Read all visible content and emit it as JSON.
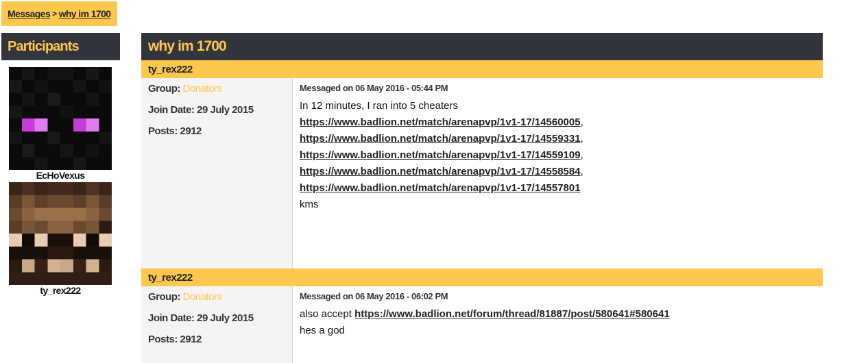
{
  "breadcrumb": {
    "root": "Messages",
    "sep": ">",
    "current": "why im 1700"
  },
  "participants": {
    "heading": "Participants",
    "list": [
      {
        "name": "EcHoVexus",
        "avatar": "enderman-skin-avatar"
      },
      {
        "name": "ty_rex222",
        "avatar": "brown-skin-avatar"
      }
    ]
  },
  "thread": {
    "title": "why im 1700",
    "messages": [
      {
        "author": "ty_rex222",
        "group_label": "Group:",
        "group": "Donators",
        "join": "Join Date: 29 July 2015",
        "posts": "Posts: 2912",
        "meta": "Messaged on 06 May 2016 - 05:44 PM",
        "intro": "In 12 minutes, I ran into 5 cheaters",
        "links": [
          "https://www.badlion.net/match/arenapvp/1v1-17/14560005",
          "https://www.badlion.net/match/arenapvp/1v1-17/14559331",
          "https://www.badlion.net/match/arenapvp/1v1-17/14559109",
          "https://www.badlion.net/match/arenapvp/1v1-17/14558584",
          "https://www.badlion.net/match/arenapvp/1v1-17/14557801"
        ],
        "comma": ",",
        "outro": "kms"
      },
      {
        "author": "ty_rex222",
        "group_label": "Group:",
        "group": "Donators",
        "join": "Join Date: 29 July 2015",
        "posts": "Posts: 2912",
        "meta": "Messaged on 06 May 2016 - 06:02 PM",
        "prefix": "also accept",
        "link": "https://www.badlion.net/forum/thread/81887/post/580641#580641",
        "outro": "hes a god"
      }
    ]
  },
  "colors": {
    "accent": "#fec84f",
    "dark": "#33353c",
    "side_bg": "#f4f4f4"
  }
}
